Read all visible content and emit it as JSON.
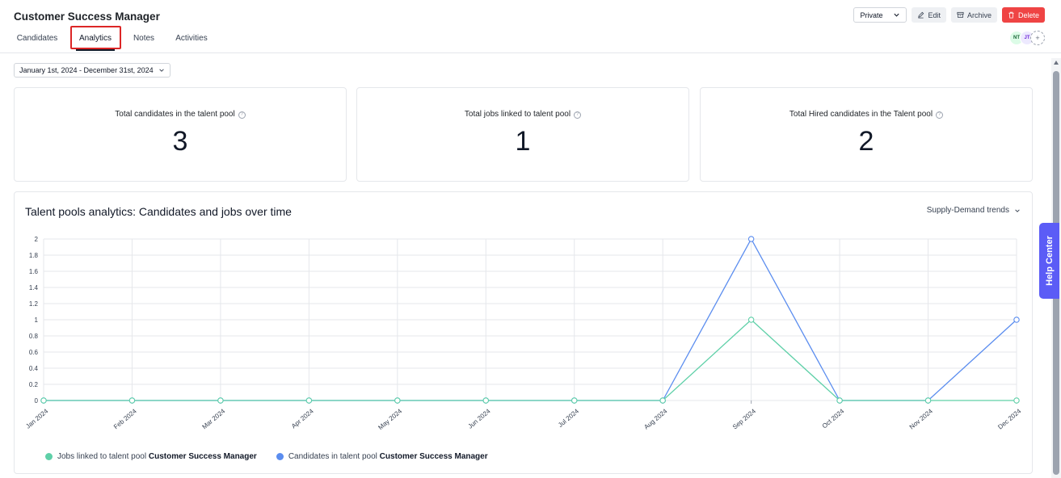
{
  "header": {
    "title": "Customer Success Manager",
    "tabs": [
      {
        "label": "Candidates"
      },
      {
        "label": "Analytics"
      },
      {
        "label": "Notes"
      },
      {
        "label": "Activities"
      }
    ],
    "visibility_select": "Private",
    "edit_label": "Edit",
    "archive_label": "Archive",
    "delete_label": "Delete",
    "avatars": [
      "NT",
      "JT",
      "+"
    ]
  },
  "filter": {
    "date_range": "January 1st, 2024 - December 31st, 2024"
  },
  "stats": [
    {
      "label": "Total candidates in the talent pool",
      "value": "3"
    },
    {
      "label": "Total jobs linked to talent pool",
      "value": "1"
    },
    {
      "label": "Total Hired candidates in the Talent pool",
      "value": "2"
    }
  ],
  "chart_card": {
    "title": "Talent pools analytics: Candidates and jobs over time",
    "dropdown_label": "Supply-Demand trends"
  },
  "legend": [
    {
      "prefix": "Jobs linked to talent pool ",
      "strong": "Customer Success Manager",
      "color": "#5fd0a8"
    },
    {
      "prefix": "Candidates in talent pool ",
      "strong": "Customer Success Manager",
      "color": "#5b8def"
    }
  ],
  "help_center_label": "Help Center",
  "chart_data": {
    "type": "line",
    "categories": [
      "Jan 2024",
      "Feb 2024",
      "Mar 2024",
      "Apr 2024",
      "May 2024",
      "Jun 2024",
      "Jul 2024",
      "Aug 2024",
      "Sep 2024",
      "Oct 2024",
      "Nov 2024",
      "Dec 2024"
    ],
    "series": [
      {
        "name": "Jobs linked to talent pool Customer Success Manager",
        "color": "#5fd0a8",
        "values": [
          0,
          0,
          0,
          0,
          0,
          0,
          0,
          0,
          1,
          0,
          0,
          0
        ]
      },
      {
        "name": "Candidates in talent pool Customer Success Manager",
        "color": "#5b8def",
        "values": [
          0,
          0,
          0,
          0,
          0,
          0,
          0,
          0,
          2,
          0,
          0,
          1
        ]
      }
    ],
    "yticks": [
      "0",
      "0.2",
      "0.4",
      "0.6",
      "0.8",
      "1",
      "1.2",
      "1.4",
      "1.6",
      "1.8",
      "2"
    ],
    "ylim": [
      0,
      2
    ],
    "grid": true
  }
}
